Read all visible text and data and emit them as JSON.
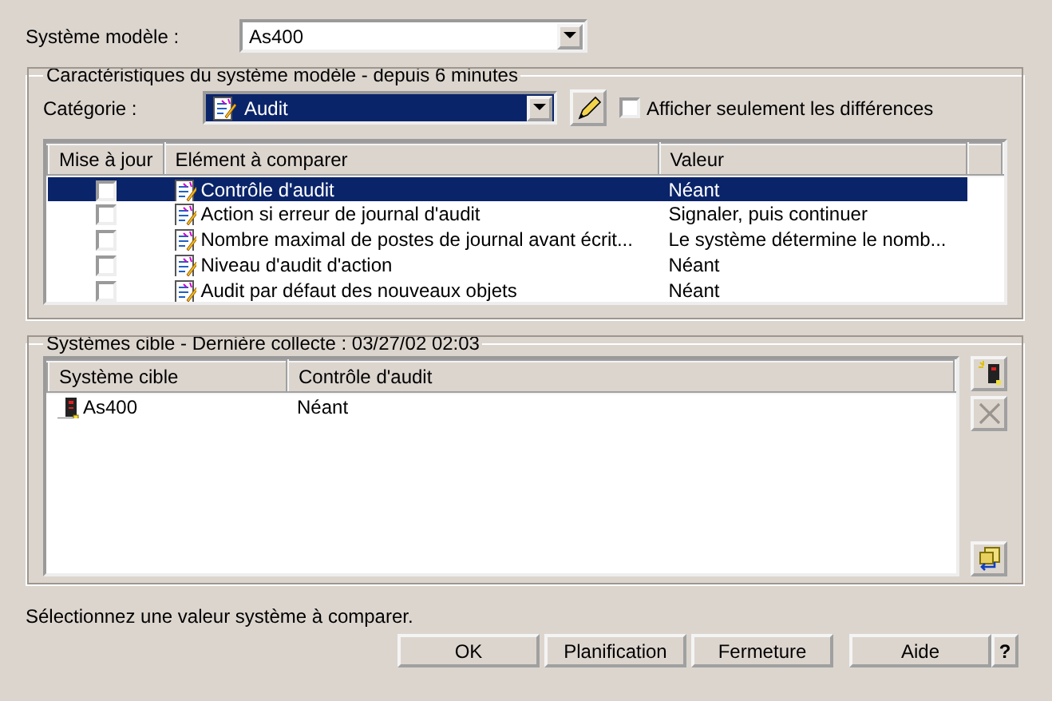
{
  "model_system": {
    "label": "Système modèle :",
    "value": "As400"
  },
  "characteristics": {
    "title": "Caractéristiques du système modèle - depuis 6 minutes",
    "category": {
      "label": "Catégorie :",
      "value": "Audit"
    },
    "show_differences": {
      "label": "Afficher seulement les différences",
      "checked": false
    },
    "table": {
      "columns": [
        "Mise à jour",
        "Elément à comparer",
        "Valeur"
      ],
      "rows": [
        {
          "update": false,
          "element": "Contrôle d'audit",
          "value": "Néant",
          "selected": true
        },
        {
          "update": false,
          "element": "Action si erreur de journal d'audit",
          "value": "Signaler, puis continuer",
          "selected": false
        },
        {
          "update": false,
          "element": "Nombre maximal de postes de journal avant écrit...",
          "value": "Le système détermine le nomb...",
          "selected": false
        },
        {
          "update": false,
          "element": "Niveau d'audit d'action",
          "value": "Néant",
          "selected": false
        },
        {
          "update": false,
          "element": "Audit par défaut des nouveaux objets",
          "value": "Néant",
          "selected": false
        }
      ]
    }
  },
  "targets": {
    "title": "Systèmes cible - Dernière collecte : 03/27/02 02:03",
    "table": {
      "columns": [
        "Système cible",
        "Contrôle d'audit"
      ],
      "rows": [
        {
          "system": "As400",
          "value": "Néant",
          "selected": false
        }
      ]
    },
    "side_buttons": [
      {
        "kind": "add",
        "disabled": false
      },
      {
        "kind": "remove",
        "disabled": true
      },
      {
        "kind": "import",
        "disabled": false
      }
    ]
  },
  "status": "Sélectionnez une valeur système à comparer.",
  "buttons": [
    {
      "label": "OK",
      "kind": "wide"
    },
    {
      "label": "Planification",
      "kind": "wide"
    },
    {
      "label": "Fermeture",
      "kind": "wide"
    },
    {
      "label": "Aide",
      "kind": "wide"
    },
    {
      "label": "?",
      "kind": "narrow"
    }
  ]
}
